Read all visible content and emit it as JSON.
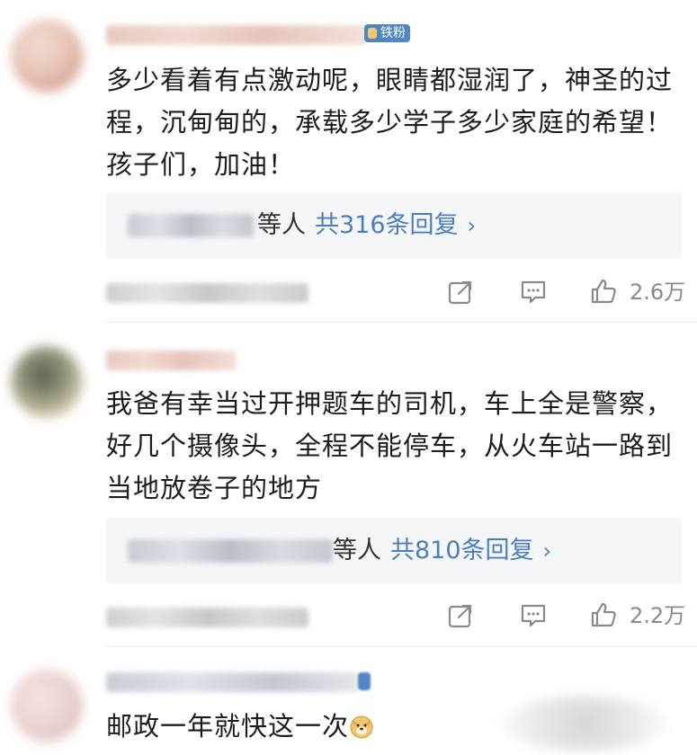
{
  "comments": [
    {
      "badge_label": "铁粉",
      "text": "多少看着有点激动呢，眼睛都湿润了，神圣的过程，沉甸甸的，承载多少学子多少家庭的希望！孩子们，加油！",
      "reply_suffix": "等人",
      "reply_link": "共316条回复",
      "reply_chevron": "›",
      "likes": "2.6万",
      "avatar_colors": [
        "#e7c4b6",
        "#c98a7a",
        "#f1dcd3"
      ]
    },
    {
      "badge_label": "",
      "text": "我爸有幸当过开押题车的司机，车上全是警察，好几个摄像头，全程不能停车，从火车站一路到当地放卷子的地方",
      "reply_suffix": "等人",
      "reply_link": "共810条回复",
      "reply_chevron": "›",
      "likes": "2.2万",
      "avatar_colors": [
        "#8b8d79",
        "#cfc8a8",
        "#efe6c8"
      ]
    },
    {
      "badge_label": "",
      "text": "邮政一年就快这一次",
      "emoji": "doge-emoji",
      "avatar_colors": [
        "#e8d2cf",
        "#d6b3ae",
        "#f3e5e2"
      ]
    }
  ],
  "icons": {
    "share": "share-icon",
    "comment": "comment-icon",
    "like": "like-icon"
  },
  "colors": {
    "link": "#4a7fbf",
    "badge": "#4f86c6",
    "reply_bg": "#f5f6f8"
  }
}
